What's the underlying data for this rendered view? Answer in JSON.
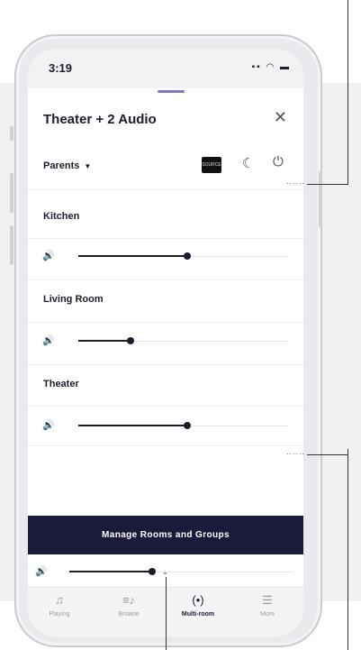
{
  "status_bar": {
    "time": "3:19",
    "icons": "▪▪ ◠ ▬"
  },
  "sheet": {
    "title": "Theater + 2 Audio",
    "close": "✕"
  },
  "controls": {
    "zone_selector": "Parents",
    "zone_caret": "▼",
    "source_badge": "SOURCE",
    "moon": "☾",
    "power": "⏻"
  },
  "rooms": [
    {
      "name": "Kitchen",
      "volume": 0.52
    },
    {
      "name": "Living Room",
      "volume": 0.25
    },
    {
      "name": "Theater",
      "volume": 0.52
    }
  ],
  "speaker_icon": "🔊",
  "manage_button": "Manage Rooms and Groups",
  "manage_arrow": "▲",
  "master_volume": 0.37,
  "tabs": [
    {
      "label": "Playing",
      "icon": "♫",
      "active": false
    },
    {
      "label": "Browse",
      "icon": "≡♪",
      "active": false
    },
    {
      "label": "Multi-room",
      "icon": "(•)",
      "active": true
    },
    {
      "label": "More",
      "icon": "☰",
      "active": false
    }
  ],
  "callout_dots": "......",
  "colors": {
    "accent": "#1a1a3a",
    "grabber": "#7f78b8",
    "background": "#f0f1f3"
  }
}
